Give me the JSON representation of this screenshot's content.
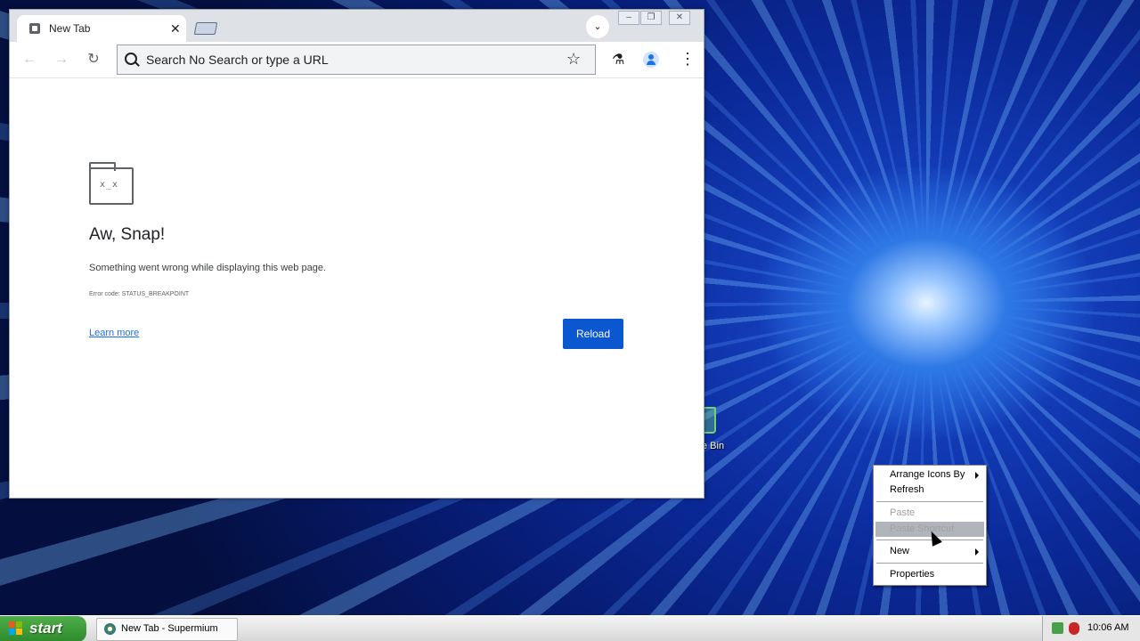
{
  "desktop": {
    "recycle_bin_label": "e Bin"
  },
  "browser": {
    "tab": {
      "title": "New Tab",
      "close": "✕"
    },
    "tab_search_glyph": "⌄",
    "window_controls": {
      "minimize": "–",
      "restore": "❐",
      "close": "✕"
    },
    "nav": {
      "back": "←",
      "forward": "→",
      "reload": "↻"
    },
    "omnibox": {
      "placeholder": "Search No Search or type a URL",
      "bookmark": "☆"
    },
    "labs_glyph": "⚗",
    "menu_glyph": "⋮",
    "error_page": {
      "face": "x_x",
      "heading": "Aw, Snap!",
      "description": "Something went wrong while displaying this web page.",
      "error_code": "Error code: STATUS_BREAKPOINT",
      "learn_more": "Learn more",
      "reload_button": "Reload"
    }
  },
  "context_menu": {
    "items": [
      {
        "label": "Arrange Icons By",
        "has_submenu": true,
        "enabled": true
      },
      {
        "label": "Refresh",
        "has_submenu": false,
        "enabled": true
      },
      {
        "label": "Paste",
        "has_submenu": false,
        "enabled": false
      },
      {
        "label": "Paste Shortcut",
        "has_submenu": false,
        "enabled": false,
        "highlighted": true
      },
      {
        "label": "New",
        "has_submenu": true,
        "enabled": true
      },
      {
        "label": "Properties",
        "has_submenu": false,
        "enabled": true
      }
    ]
  },
  "taskbar": {
    "start_label": "start",
    "task_button_label": "New Tab - Supermium",
    "clock": "10:06 AM"
  },
  "colors": {
    "accent": "#0b57d0",
    "start_green": "#3a9d37",
    "desktop_blue": "#0b2a9a"
  }
}
